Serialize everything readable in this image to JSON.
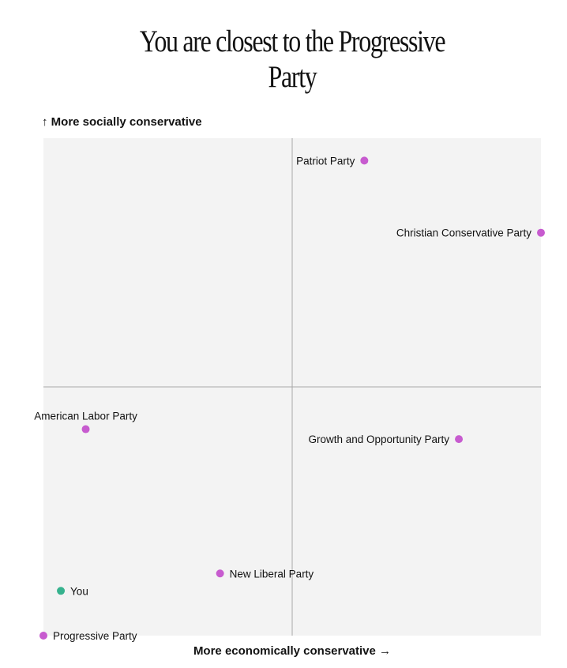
{
  "title": {
    "line1": "You are closest to the Progressive",
    "line2": "Party"
  },
  "chart_data": {
    "type": "scatter",
    "xlabel": "More economically conservative →",
    "ylabel": "↑ More socially conservative",
    "xlim": [
      -1,
      1
    ],
    "ylim": [
      -1,
      1
    ],
    "grid": false,
    "points": [
      {
        "name": "Patriot Party",
        "x": 0.29,
        "y": 0.91,
        "color": "#c75bcf",
        "label_side": "left"
      },
      {
        "name": "Christian Conservative Party",
        "x": 1.0,
        "y": 0.62,
        "color": "#c75bcf",
        "label_side": "left"
      },
      {
        "name": "American Labor Party",
        "x": -0.83,
        "y": -0.17,
        "color": "#c75bcf",
        "label_side": "above"
      },
      {
        "name": "Growth and Opportunity Party",
        "x": 0.67,
        "y": -0.21,
        "color": "#c75bcf",
        "label_side": "left"
      },
      {
        "name": "New Liberal Party",
        "x": -0.29,
        "y": -0.75,
        "color": "#c75bcf",
        "label_side": "right"
      },
      {
        "name": "You",
        "x": -0.93,
        "y": -0.82,
        "color": "#36b28e",
        "label_side": "right"
      },
      {
        "name": "Progressive Party",
        "x": -1.0,
        "y": -1.0,
        "color": "#c75bcf",
        "label_side": "right"
      }
    ]
  },
  "colors": {
    "plot_background": "#f3f3f3",
    "axis_lines": "#a8a8a8",
    "party_dot": "#c75bcf",
    "you_dot": "#36b28e"
  }
}
